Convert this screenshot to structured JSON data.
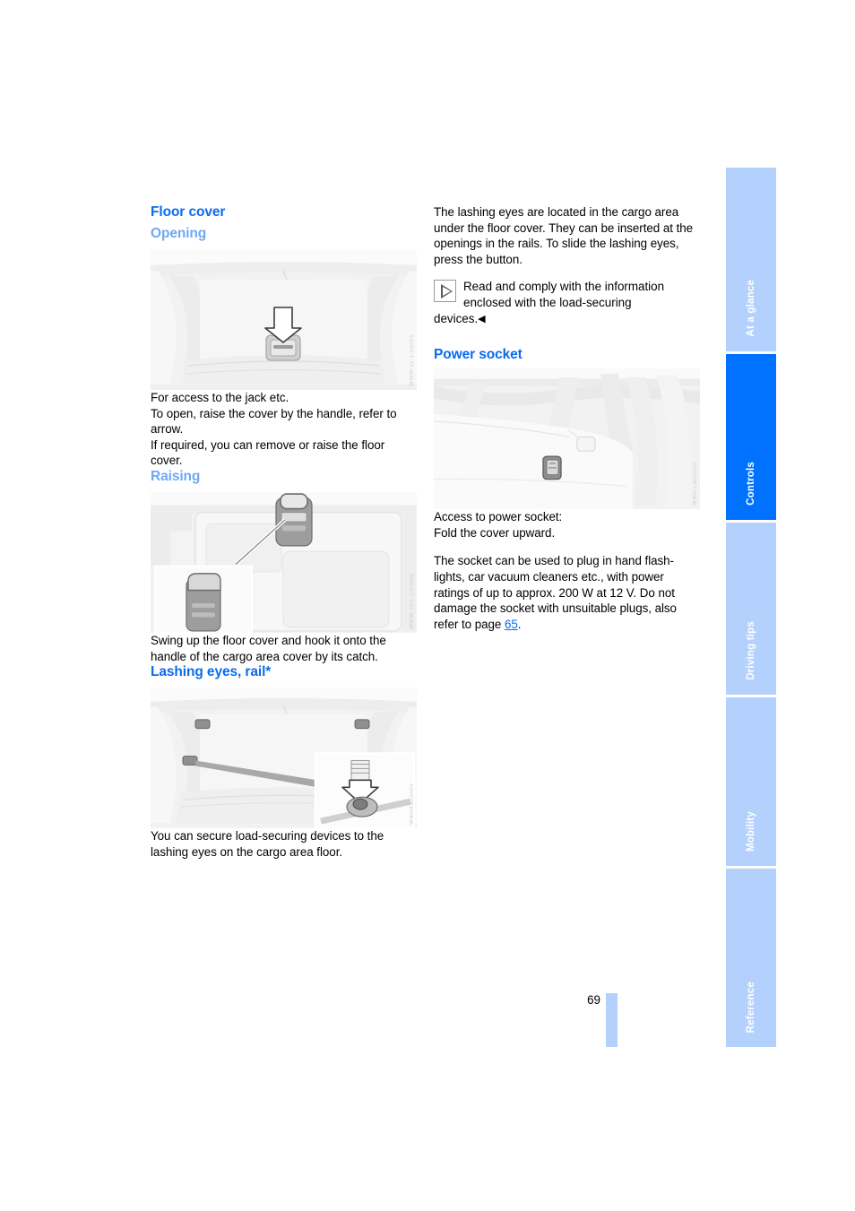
{
  "document": {
    "page_number": "69",
    "accent_color": "#0a6bf0",
    "subheading_color": "#6fa8f5",
    "tab_active_color": "#0072ff",
    "tab_inactive_color": "#b3d1fc"
  },
  "left_column": {
    "section_title": "Floor cover",
    "opening": {
      "title": "Opening",
      "figure_code": "WWW-31-1-03AKv",
      "figure_name": "cargo-area-floor-cover-handle-illustration",
      "paragraph": "For access to the jack etc.\nTo open, raise the cover by the handle, refer to arrow.\nIf required, you can remove or raise the floor cover."
    },
    "raising": {
      "title": "Raising",
      "figure_code": "WWW-TR1-1-03ABk",
      "figure_name": "floor-cover-catch-handle-illustration",
      "paragraph": "Swing up the floor cover and hook it onto the handle of the cargo area cover by its catch."
    },
    "lashing_eyes": {
      "title": "Lashing eyes, rail*",
      "figure_code": "WWOK903AKv",
      "figure_name": "lashing-eyes-cargo-floor-illustration",
      "paragraph": "You can secure load-securing devices to the lashing eyes on the cargo area floor."
    }
  },
  "right_column": {
    "lashing_intro": "The lashing eyes are located in the cargo area under the floor cover. They can be inserted at the openings in the rails. To slide the lashing eyes, press the button.",
    "note": {
      "icon": "note-triangle-icon",
      "text": "Read and comply with the information enclosed with the load-securing",
      "trailing_text": "devices.",
      "end_marker": "◀"
    },
    "power_socket": {
      "title": "Power socket",
      "figure_code": "WWO-La003Un",
      "figure_name": "power-socket-cargo-area-illustration",
      "access_paragraph": "Access to power socket:\nFold the cover upward.",
      "description_prefix": "The socket can be used to plug in hand flash-lights, car vacuum cleaners etc., with power ratings of up to approx. 200 W at 12 V. Do not damage the socket with unsuitable plugs, also refer to page ",
      "page_link": "65",
      "description_suffix": "."
    }
  },
  "tabs": [
    {
      "label": "At a glance",
      "active": false
    },
    {
      "label": "Controls",
      "active": true
    },
    {
      "label": "Driving tips",
      "active": false
    },
    {
      "label": "Mobility",
      "active": false
    },
    {
      "label": "Reference",
      "active": false
    }
  ]
}
